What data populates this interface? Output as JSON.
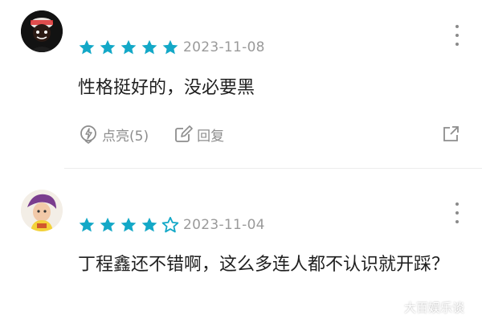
{
  "comments": [
    {
      "rating": 5,
      "date": "2023-11-08",
      "text": "性格挺好的，没必要黑",
      "like_label": "点亮(5)",
      "reply_label": "回复"
    },
    {
      "rating": 4,
      "date": "2023-11-04",
      "text": "丁程鑫还不错啊，这么多连人都不认识就开踩？"
    }
  ],
  "watermark": "大百娱乐谈",
  "colors": {
    "star": "#13a8c7",
    "meta": "#9a9a9a",
    "icon": "#8d8d8d"
  }
}
